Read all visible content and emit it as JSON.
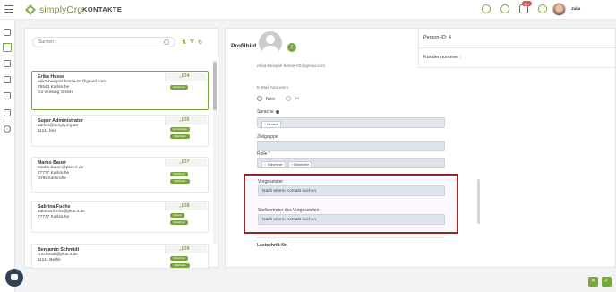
{
  "header": {
    "logo_text": "simplyOrg",
    "title": "KONTAKTE",
    "notification_count": "99+",
    "user_name": "Julia"
  },
  "search": {
    "placeholder": "Suchen"
  },
  "contacts": [
    {
      "name": "Erika Hesse",
      "lines": [
        "erika-beispiel.hesse-02@gmail.com",
        "76543 Karlsruhe",
        "Co-working GmbH"
      ],
      "id": "ID4",
      "tags": [
        "Teilnehmer"
      ],
      "selected": true
    },
    {
      "name": "Super Administrator",
      "lines": [
        "admin@simplyorg.de",
        "11111 berl"
      ],
      "id": "ID5",
      "tags": [
        "Administrator",
        "Mitarbeiter"
      ]
    },
    {
      "name": "Marko Bauer",
      "lines": [
        "marko.bauer@plus-it.de",
        "77777 Karlsruhe",
        "DHK Karlsruhe"
      ],
      "id": "ID7",
      "tags": [
        "Teilnehmer",
        "Mitarbeiter"
      ]
    },
    {
      "name": "Sabrina Fuchs",
      "lines": [
        "sabrina.fuchs@plus-it.de",
        "77777 Karlsruhe"
      ],
      "id": "ID8",
      "tags": [
        "Dozent",
        "Teilnehmer"
      ]
    },
    {
      "name": "Benjamin Schmidt",
      "lines": [
        "b.schmidt@plus-it.de",
        "11111 Berlin"
      ],
      "id": "ID9",
      "tags": [
        "Teilnehmer",
        "Mitarbeiter"
      ]
    }
  ],
  "profile": {
    "label": "Profilbild",
    "person_id": "Person-ID: 4",
    "kundennummer": "Kundennummer :"
  },
  "form": {
    "email_value": "erika-beispiel.hesse-02@gmail.com",
    "email_abonnent_label": "E-Mail Abonnent",
    "radio_no": "Nein",
    "radio_yes": "Ja",
    "sprache_label": "Sprache",
    "sprache_chip": "Deutsch",
    "zielgruppe_label": "Zielgruppe",
    "rolle_label": "Rolle *",
    "rolle_chips": [
      "Teilnehmer",
      "Mitarbeiter"
    ],
    "vorgesetzter_label": "Vorgesetzter",
    "vorgesetzter_value": "Nach einem Kontakt suchen",
    "stellvertreter_label": "Stellvertreter des Vorgesetzten",
    "stellvertreter_value": "Nach einem Kontakt suchen",
    "lastschrift_label": "Lastschrift-Nr."
  },
  "colors": {
    "accent": "#7aa73a",
    "highlight_border": "#8b2a26",
    "input_bg": "#dfe3ea"
  }
}
